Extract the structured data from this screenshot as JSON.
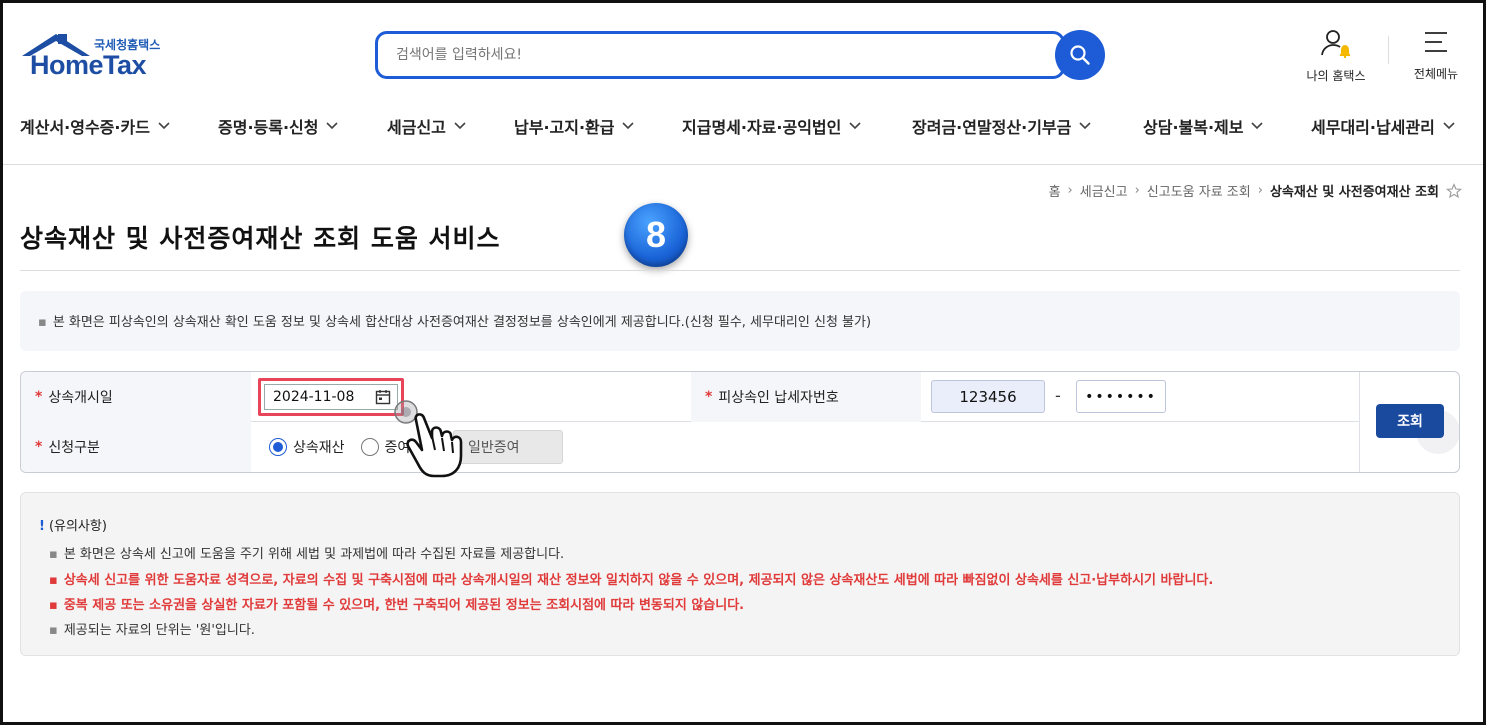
{
  "header": {
    "logo_small": "국세청홈택스",
    "logo_main": "HomeTax",
    "search_placeholder": "검색어를 입력하세요!",
    "my_hometax": "나의 홈택스",
    "all_menu": "전체메뉴"
  },
  "gnb": [
    {
      "label": "계산서·영수증·카드"
    },
    {
      "label": "증명·등록·신청"
    },
    {
      "label": "세금신고"
    },
    {
      "label": "납부·고지·환급"
    },
    {
      "label": "지급명세·자료·공익법인"
    },
    {
      "label": "장려금·연말정산·기부금"
    },
    {
      "label": "상담·불복·제보"
    },
    {
      "label": "세무대리·납세관리"
    }
  ],
  "breadcrumb": {
    "home": "홈",
    "level1": "세금신고",
    "level2": "신고도움 자료 조회",
    "current": "상속재산 및 사전증여재산 조회"
  },
  "page": {
    "title": "상속재산 및 사전증여재산 조회 도움 서비스",
    "step_number": "8",
    "info": "본 화면은 피상속인의 상속재산 확인 도움 정보 및 상속세 합산대상 사전증여재산 결정정보를 상속인에게 제공합니다.(신청 필수, 세무대리인 신청 불가)"
  },
  "form": {
    "start_date_label": "상속개시일",
    "start_date_value": "2024-11-08",
    "taxpayer_label": "피상속인 납세자번호",
    "ssn_front": "123456",
    "ssn_dash": "-",
    "ssn_back": "•••••••",
    "request_type_label": "신청구분",
    "radio_inherit": "상속재산",
    "radio_gift": "증여",
    "gift_select": "일반증여",
    "search_button": "조회"
  },
  "notice": {
    "title": "(유의사항)",
    "lines": [
      "본 화면은 상속세 신고에 도움을 주기 위해 세법 및 과제법에 따라 수집된 자료를 제공합니다.",
      "상속세 신고를 위한 도움자료 성격으로, 자료의 수집 및 구축시점에 따라 상속개시일의 재산 정보와 일치하지 않을 수 있으며, 제공되지 않은 상속재산도 세법에 따라 빠짐없이 상속세를 신고·납부하시기 바랍니다.",
      "중복 제공 또는 소유권을 상실한 자료가 포함될 수 있으며, 한번 구축되어 제공된 정보는 조회시점에 따라 변동되지 않습니다.",
      "제공되는 자료의 단위는 '원'입니다."
    ]
  },
  "colors": {
    "brand_blue": "#1e5bd6",
    "button_navy": "#1a4a9e",
    "required_red": "#e03a3a",
    "highlight_border": "#e8445a"
  }
}
